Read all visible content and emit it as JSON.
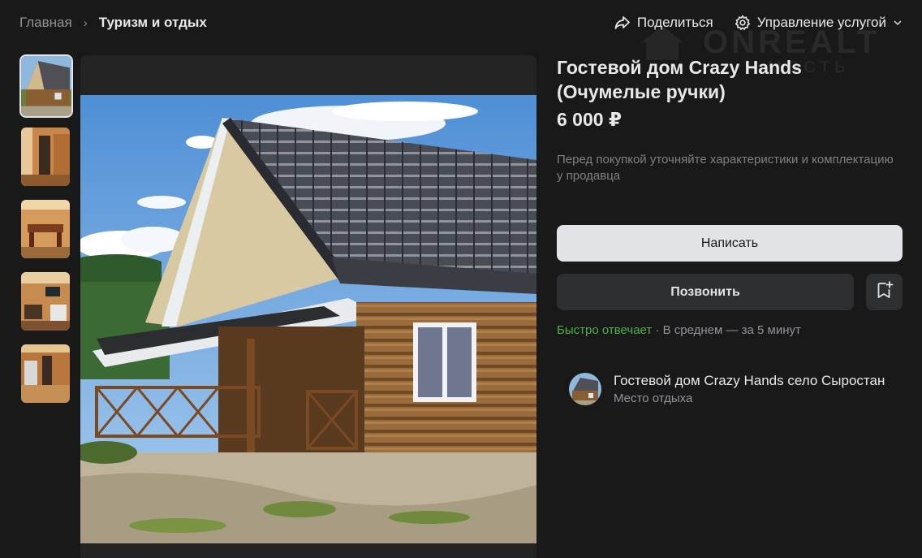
{
  "breadcrumb": {
    "home": "Главная",
    "separator": "›",
    "current": "Туризм и отдых"
  },
  "header_actions": {
    "share": "Поделиться",
    "manage": "Управление услугой"
  },
  "watermark": {
    "main": "ONREALT",
    "sub": "МОСТЬ"
  },
  "gallery": {
    "thumbnails": [
      "exterior",
      "interior-hall",
      "interior-dining",
      "interior-kitchen",
      "interior-room"
    ],
    "selected_index": 0
  },
  "listing": {
    "title": "Гостевой дом Crazy Hands (Очумелые ручки)",
    "price": "6 000 ₽",
    "note": "Перед покупкой уточняйте характеристики и комплектацию у продавца"
  },
  "buttons": {
    "write": "Написать",
    "call": "Позвонить"
  },
  "response": {
    "fast": "Быстро отвечает",
    "rest": " · В среднем — за 5 минут"
  },
  "seller": {
    "name": "Гостевой дом Crazy Hands село Сыростан",
    "type": "Место отдыха"
  },
  "colors": {
    "background": "#19191a",
    "primary_button": "#e1e3e6",
    "secondary_button": "#2e2f30",
    "fast_response": "#4bb34b"
  },
  "icons": {
    "share": "share-arrow-icon",
    "manage": "gear-icon",
    "dropdown": "chevron-down-icon",
    "save": "bookmark-add-icon"
  }
}
